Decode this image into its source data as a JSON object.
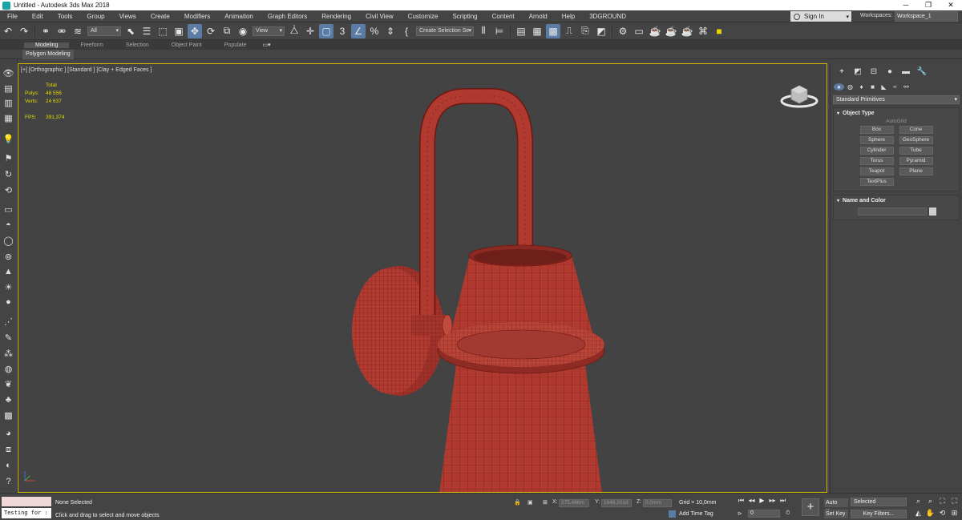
{
  "window": {
    "title": "Untitled - Autodesk 3ds Max 2018",
    "minimize": "─",
    "maximize": "❐",
    "close": "✕"
  },
  "menu": [
    "File",
    "Edit",
    "Tools",
    "Group",
    "Views",
    "Create",
    "Modifiers",
    "Animation",
    "Graph Editors",
    "Rendering",
    "Civil View",
    "Customize",
    "Scripting",
    "Content",
    "Arnold",
    "Help",
    "3DGROUND"
  ],
  "account": {
    "sign_in": "Sign In",
    "workspaces_label": "Workspaces:",
    "workspace": "Workspace_1"
  },
  "toolbar": {
    "filter": "All",
    "ref_coord": "View",
    "snap_angle": "3",
    "selection_set": "Create Selection Se"
  },
  "ribbon": {
    "tabs": [
      "Modeling",
      "Freeform",
      "Selection",
      "Object Paint",
      "Populate"
    ],
    "active_tab": "Modeling",
    "panel": "Polygon Modeling"
  },
  "viewport": {
    "label": "[+] [Orthographic ] [Standard ] [Clay + Edged Faces ]",
    "stats": {
      "header": "Total",
      "polys_label": "Polys:",
      "polys": "48 556",
      "verts_label": "Verts:",
      "verts": "24 637",
      "fps_label": "FPS:",
      "fps": "391,374"
    }
  },
  "command_panel": {
    "category": "Standard Primitives",
    "object_type_title": "Object Type",
    "autogrid": "AutoGrid",
    "primitives": [
      "Box",
      "Cone",
      "Sphere",
      "GeoSphere",
      "Cylinder",
      "Tube",
      "Torus",
      "Pyramid",
      "Teapot",
      "Plane",
      "TextPlus"
    ],
    "name_color_title": "Name and Color"
  },
  "status": {
    "script_text": "Testing for :",
    "selection": "None Selected",
    "hint": "Click and drag to select and move objects",
    "x_label": "X:",
    "x_value": "275,466m",
    "y_label": "Y:",
    "y_value": "1646,2018",
    "z_label": "Z:",
    "z_value": "0,0mm",
    "grid": "Grid = 10,0mm",
    "add_time_tag": "Add Time Tag",
    "frame": "0",
    "auto_key": "Auto Key",
    "set_key": "Set Key",
    "key_set": "Selected",
    "key_filters": "Key Filters..."
  },
  "colors": {
    "accent": "#5a7ba3",
    "viewport_border": "#d6b800",
    "stats_text": "#e4dd00",
    "model_fill": "#b03a30",
    "model_wire": "#6e1712"
  }
}
